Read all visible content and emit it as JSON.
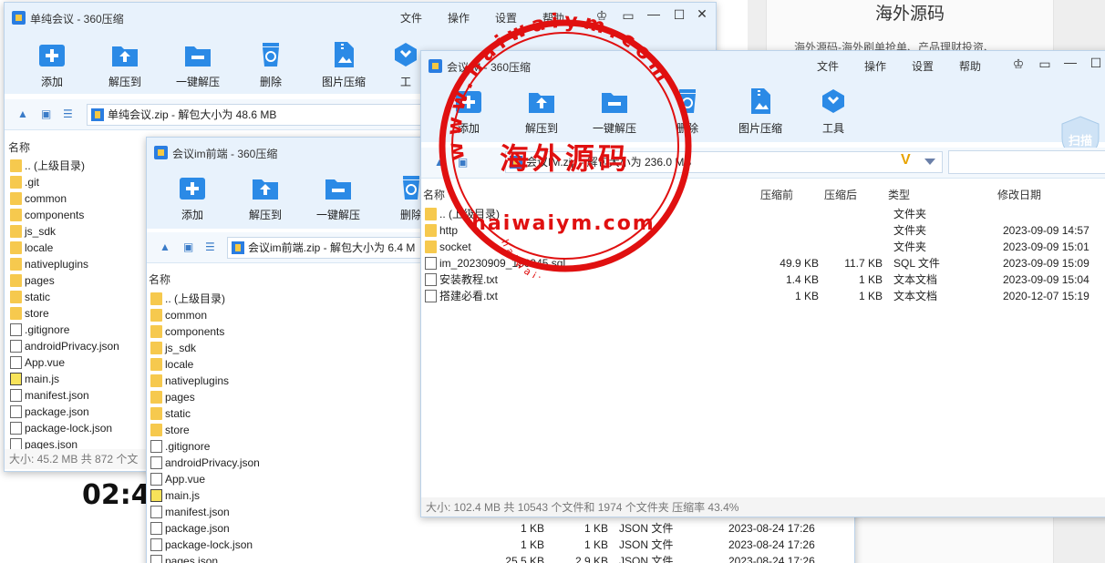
{
  "background": {
    "article_title": "海外源码",
    "article_line": "海外源码-海外刷单抢单、产品理财投资、",
    "clock": "02:4"
  },
  "menus": [
    "文件",
    "操作",
    "设置",
    "帮助"
  ],
  "toolbar": {
    "add": "添加",
    "extract_to": "解压到",
    "one_click": "一键解压",
    "delete": "删除",
    "image_compress": "图片压缩",
    "tools": "工具",
    "tools_cut": "工"
  },
  "columns": {
    "name": "名称",
    "packed": "压缩前",
    "compressed": "压缩后",
    "type": "类型",
    "modified": "修改日期"
  },
  "window1": {
    "title": "单纯会议 - 360压缩",
    "address": "单纯会议.zip - 解包大小为 48.6 MB",
    "files": [
      {
        "name": ".. (上级目录)",
        "icon": "folder"
      },
      {
        "name": ".git",
        "icon": "folder"
      },
      {
        "name": "common",
        "icon": "folder"
      },
      {
        "name": "components",
        "icon": "folder"
      },
      {
        "name": "js_sdk",
        "icon": "folder"
      },
      {
        "name": "locale",
        "icon": "folder"
      },
      {
        "name": "nativeplugins",
        "icon": "folder"
      },
      {
        "name": "pages",
        "icon": "folder"
      },
      {
        "name": "static",
        "icon": "folder"
      },
      {
        "name": "store",
        "icon": "folder"
      },
      {
        "name": ".gitignore",
        "icon": "file"
      },
      {
        "name": "androidPrivacy.json",
        "icon": "file"
      },
      {
        "name": "App.vue",
        "icon": "file"
      },
      {
        "name": "main.js",
        "icon": "js"
      },
      {
        "name": "manifest.json",
        "icon": "file"
      },
      {
        "name": "package.json",
        "icon": "file"
      },
      {
        "name": "package-lock.json",
        "icon": "file"
      },
      {
        "name": "pages.json",
        "icon": "file"
      }
    ],
    "status": "大小: 45.2 MB 共 872 个文"
  },
  "window2": {
    "title": "会议im前端 - 360压缩",
    "address": "会议im前端.zip - 解包大小为 6.4 M",
    "files": [
      {
        "name": ".. (上级目录)",
        "icon": "folder",
        "packed": "",
        "compressed": "",
        "type": "",
        "modified": ""
      },
      {
        "name": "common",
        "icon": "folder",
        "packed": "",
        "compressed": "",
        "type": "",
        "modified": ""
      },
      {
        "name": "components",
        "icon": "folder",
        "packed": "",
        "compressed": "",
        "type": "",
        "modified": ""
      },
      {
        "name": "js_sdk",
        "icon": "folder",
        "packed": "",
        "compressed": "",
        "type": "",
        "modified": ""
      },
      {
        "name": "locale",
        "icon": "folder",
        "packed": "",
        "compressed": "",
        "type": "",
        "modified": ""
      },
      {
        "name": "nativeplugins",
        "icon": "folder",
        "packed": "",
        "compressed": "",
        "type": "",
        "modified": ""
      },
      {
        "name": "pages",
        "icon": "folder",
        "packed": "",
        "compressed": "",
        "type": "",
        "modified": ""
      },
      {
        "name": "static",
        "icon": "folder",
        "packed": "",
        "compressed": "",
        "type": "",
        "modified": ""
      },
      {
        "name": "store",
        "icon": "folder",
        "packed": "",
        "compressed": "",
        "type": "",
        "modified": ""
      },
      {
        "name": ".gitignore",
        "icon": "file",
        "packed": "",
        "compressed": "",
        "type": "",
        "modified": ""
      },
      {
        "name": "androidPrivacy.json",
        "icon": "file",
        "packed": "",
        "compressed": "",
        "type": "",
        "modified": ""
      },
      {
        "name": "App.vue",
        "icon": "file",
        "packed": "",
        "compressed": "",
        "type": "",
        "modified": ""
      },
      {
        "name": "main.js",
        "icon": "js",
        "packed": "",
        "compressed": "",
        "type": "",
        "modified": ""
      },
      {
        "name": "manifest.json",
        "icon": "file",
        "packed": "",
        "compressed": "",
        "type": "",
        "modified": ""
      },
      {
        "name": "package.json",
        "icon": "file",
        "packed": "1 KB",
        "compressed": "1 KB",
        "type": "JSON 文件",
        "modified": "2023-08-24 17:26"
      },
      {
        "name": "package-lock.json",
        "icon": "file",
        "packed": "1 KB",
        "compressed": "1 KB",
        "type": "JSON 文件",
        "modified": "2023-08-24 17:26"
      },
      {
        "name": "pages.json",
        "icon": "file",
        "packed": "25.5 KB",
        "compressed": "2.9 KB",
        "type": "JSON 文件",
        "modified": "2023-08-24 17:26"
      }
    ]
  },
  "window3": {
    "title": "会议IM - 360压缩",
    "address": "会议IM.zip - 解包大小为 236.0 MB",
    "scan": "扫描",
    "files": [
      {
        "name": ".. (上级目录)",
        "icon": "folder",
        "packed": "",
        "compressed": "",
        "type": "文件夹",
        "modified": ""
      },
      {
        "name": "http",
        "icon": "folder",
        "packed": "",
        "compressed": "",
        "type": "文件夹",
        "modified": "2023-09-09 14:57"
      },
      {
        "name": "socket",
        "icon": "folder",
        "packed": "",
        "compressed": "",
        "type": "文件夹",
        "modified": "2023-09-09 15:01"
      },
      {
        "name": "im_20230909_150945.sql",
        "icon": "file",
        "packed": "49.9 KB",
        "compressed": "11.7 KB",
        "type": "SQL 文件",
        "modified": "2023-09-09 15:09"
      },
      {
        "name": "安装教程.txt",
        "icon": "file",
        "packed": "1.4 KB",
        "compressed": "1 KB",
        "type": "文本文档",
        "modified": "2023-09-09 15:04"
      },
      {
        "name": "搭建必看.txt",
        "icon": "file",
        "packed": "1 KB",
        "compressed": "1 KB",
        "type": "文本文档",
        "modified": "2020-12-07 15:19"
      }
    ],
    "status": "大小: 102.4 MB 共 10543 个文件和 1974 个文件夹 压缩率 43.4%"
  },
  "watermark": {
    "ring_text": "www.haiwaiym.com",
    "center_text": "海外源码",
    "bottom_text": "haiwaiym.com",
    "small_ring_text": "haiwaiym.com"
  }
}
